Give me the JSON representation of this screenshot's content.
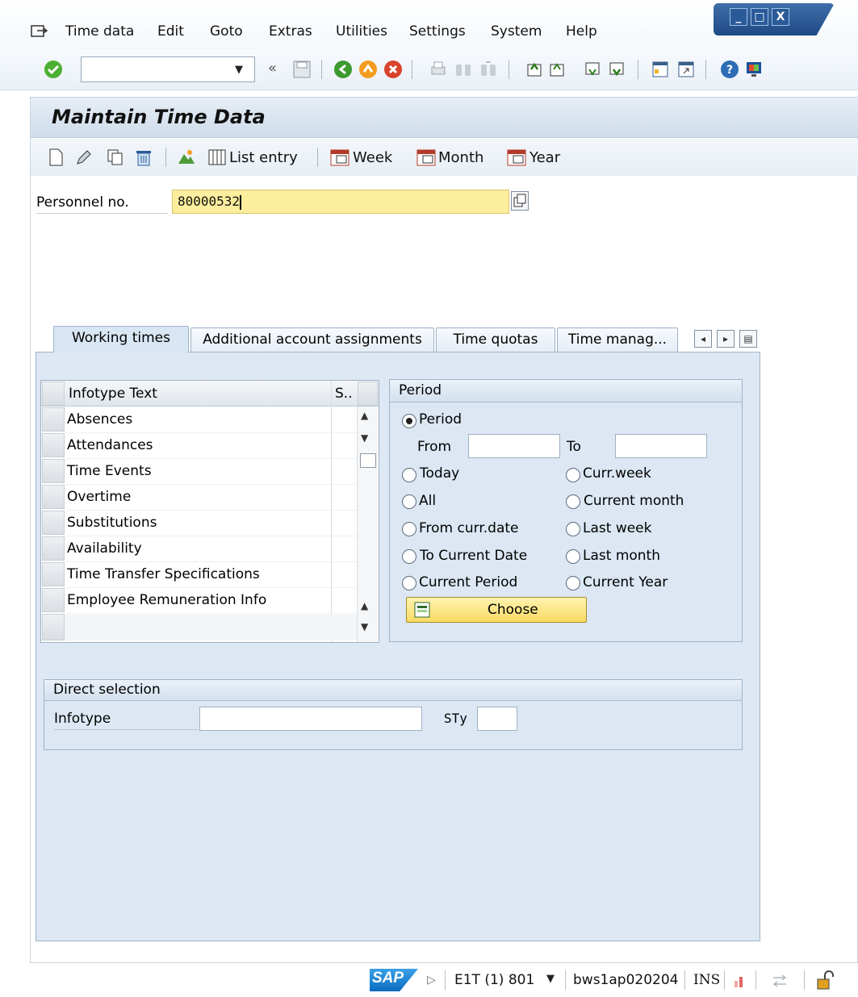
{
  "menu": {
    "items": [
      "Time data",
      "Edit",
      "Goto",
      "Extras",
      "Utilities",
      "Settings",
      "System",
      "Help"
    ]
  },
  "window_controls": {
    "minimize": "_",
    "maximize": "□",
    "close": "X"
  },
  "screen": {
    "title": "Maintain Time Data"
  },
  "app_toolbar": {
    "list_entry": "List entry",
    "week": "Week",
    "month": "Month",
    "year": "Year"
  },
  "personnel": {
    "label": "Personnel no.",
    "value": "80000532"
  },
  "tabs": [
    "Working times",
    "Additional account assignments",
    "Time quotas",
    "Time manag..."
  ],
  "infotype_list": {
    "col_text": "Infotype Text",
    "col_status": "S..",
    "rows": [
      "Absences",
      "Attendances",
      "Time Events",
      "Overtime",
      "Substitutions",
      "Availability",
      "Time Transfer Specifications",
      "Employee Remuneration Info"
    ]
  },
  "period": {
    "title": "Period",
    "period_option": "Period",
    "from_label": "From",
    "to_label": "To",
    "from_value": "",
    "to_value": "",
    "left_options": [
      "Today",
      "All",
      "From curr.date",
      "To Current Date",
      "Current Period"
    ],
    "right_options": [
      "Curr.week",
      "Current month",
      "Last week",
      "Last month",
      "Current Year"
    ],
    "selected": "Period",
    "choose_label": "Choose"
  },
  "direct_selection": {
    "title": "Direct selection",
    "infotype_label": "Infotype",
    "infotype_value": "",
    "sty_label": "STy",
    "sty_value": ""
  },
  "status_bar": {
    "logo": "SAP",
    "system": "E1T (1) 801",
    "server": "bws1ap020204",
    "mode": "INS"
  },
  "colors": {
    "accent_blue": "#1e4a85",
    "input_required": "#fcee9c",
    "choose_button": "#f8db62",
    "panel_background": "#dce7f3"
  }
}
